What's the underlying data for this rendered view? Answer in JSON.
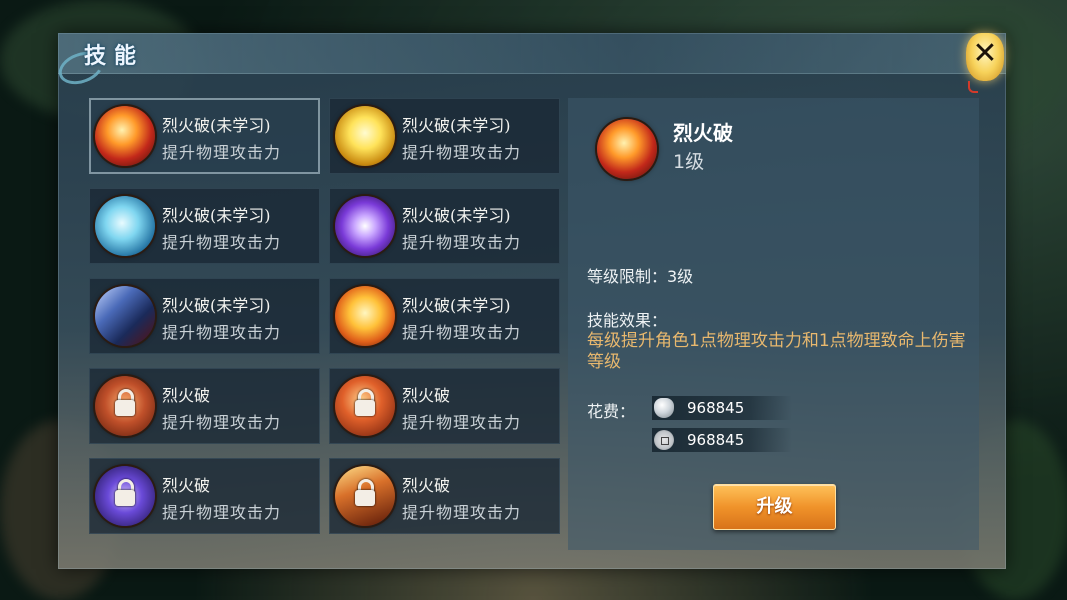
{
  "panel": {
    "title": "技能"
  },
  "skills": [
    {
      "name": "烈火破(未学习)",
      "desc": "提升物理攻击力",
      "icon": "fire-slash-icon",
      "locked": false,
      "selected": true
    },
    {
      "name": "烈火破(未学习)",
      "desc": "提升物理攻击力",
      "icon": "golden-sword-icon",
      "locked": false,
      "selected": false
    },
    {
      "name": "烈火破(未学习)",
      "desc": "提升物理攻击力",
      "icon": "blue-bird-icon",
      "locked": false,
      "selected": false
    },
    {
      "name": "烈火破(未学习)",
      "desc": "提升物理攻击力",
      "icon": "purple-orb-icon",
      "locked": false,
      "selected": false
    },
    {
      "name": "烈火破(未学习)",
      "desc": "提升物理攻击力",
      "icon": "blade-icon",
      "locked": false,
      "selected": false
    },
    {
      "name": "烈火破(未学习)",
      "desc": "提升物理攻击力",
      "icon": "fire-burst-icon",
      "locked": false,
      "selected": false
    },
    {
      "name": "烈火破",
      "desc": "提升物理攻击力",
      "icon": "locked-skill-icon",
      "locked": true,
      "selected": false
    },
    {
      "name": "烈火破",
      "desc": "提升物理攻击力",
      "icon": "locked-skill-icon",
      "locked": true,
      "selected": false
    },
    {
      "name": "烈火破",
      "desc": "提升物理攻击力",
      "icon": "locked-skill-icon",
      "locked": true,
      "selected": false
    },
    {
      "name": "烈火破",
      "desc": "提升物理攻击力",
      "icon": "locked-skill-icon",
      "locked": true,
      "selected": false
    }
  ],
  "detail": {
    "name": "烈火破",
    "level": "1级",
    "requirement": "等级限制：3级",
    "effect_label": "技能效果：",
    "effect_text": "每级提升角色1点物理攻击力和1点物理致命上伤害等级",
    "cost_label": "花费：",
    "costs": [
      {
        "icon": "silver-ingot-icon",
        "value": "968845"
      },
      {
        "icon": "copper-coin-icon",
        "value": "968845"
      }
    ],
    "upgrade_label": "升级"
  },
  "colors": {
    "effect_text": "#e8b86e",
    "button": "#f0932a"
  }
}
